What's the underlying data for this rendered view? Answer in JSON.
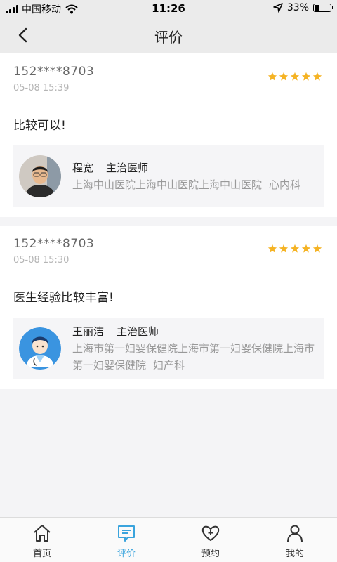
{
  "status_bar": {
    "carrier": "中国移动",
    "time": "11:26",
    "battery": "33%",
    "battery_level": 0.33
  },
  "header": {
    "title": "评价"
  },
  "reviews": [
    {
      "user": "152****8703",
      "time": "05-08 15:39",
      "rating": 5,
      "comment": "比较可以!",
      "doctor": {
        "name": "程宽",
        "title": "主治医师",
        "hospital": "上海中山医院上海中山医院上海中山医院",
        "department": "心内科"
      }
    },
    {
      "user": "152****8703",
      "time": "05-08 15:30",
      "rating": 5,
      "comment": "医生经验比较丰富!",
      "doctor": {
        "name": "王丽洁",
        "title": "主治医师",
        "hospital": "上海市第一妇婴保健院上海市第一妇婴保健院上海市第一妇婴保健院",
        "department": "妇产科"
      }
    }
  ],
  "tabs": [
    {
      "label": "首页",
      "icon": "home-icon",
      "active": false
    },
    {
      "label": "评价",
      "icon": "comment-icon",
      "active": true
    },
    {
      "label": "预约",
      "icon": "heart-plus-icon",
      "active": false
    },
    {
      "label": "我的",
      "icon": "user-icon",
      "active": false
    }
  ],
  "colors": {
    "accent": "#3aa4dd",
    "star": "#f5b324",
    "inactive": "#333333"
  }
}
